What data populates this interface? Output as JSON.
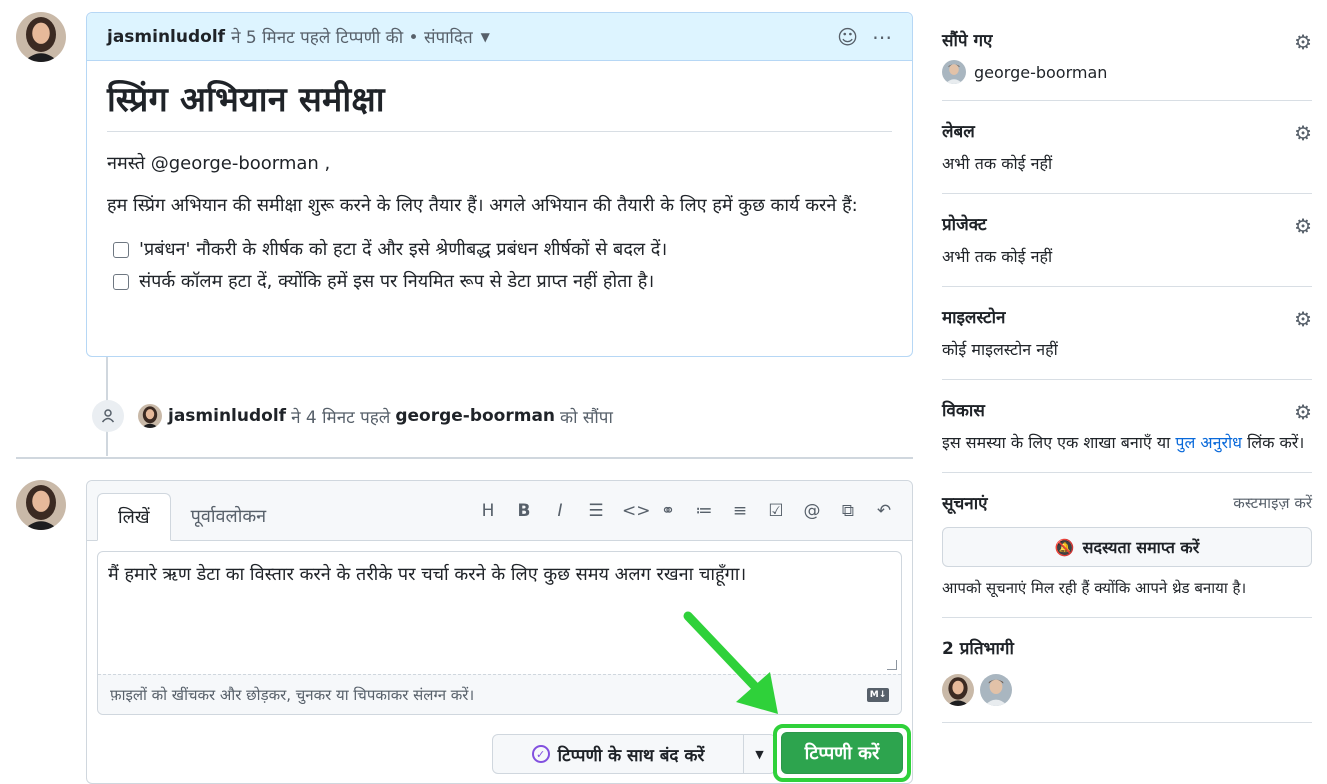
{
  "comment": {
    "author": "jasminludolf",
    "meta": "ने 5 मिनट पहले टिप्पणी की • संपादित",
    "title": "स्प्रिंग अभियान समीक्षा",
    "greeting": "नमस्ते @george-boorman ,",
    "body": "हम स्प्रिंग अभियान की समीक्षा शुरू करने के लिए तैयार हैं। अगले अभियान की तैयारी के लिए हमें कुछ कार्य करने हैं:",
    "tasks": [
      "'प्रबंधन' नौकरी के शीर्षक को हटा दें और इसे श्रेणीबद्ध प्रबंधन शीर्षकों से बदल दें।",
      "संपर्क कॉलम हटा दें, क्योंकि हमें इस पर नियमित रूप से डेटा प्राप्त नहीं होता है।"
    ]
  },
  "event": {
    "actor": "jasminludolf",
    "verb_pre": "ने 4 मिनट पहले",
    "target": "george-boorman",
    "verb_post": "को सौंपा"
  },
  "composer": {
    "tab_write": "लिखें",
    "tab_preview": "पूर्वावलोकन",
    "toolbar": [
      "H",
      "B",
      "I"
    ],
    "text": "मैं हमारे ऋण डेटा का विस्तार करने के तरीके पर चर्चा करने के लिए कुछ समय अलग रखना चाहूँगा।",
    "drop_hint": "फ़ाइलों को खींचकर और छोड़कर, चुनकर या चिपकाकर संलग्न करें।",
    "md_badge": "M↓",
    "close_label": "टिप्पणी के साथ बंद करें",
    "submit_label": "टिप्पणी करें"
  },
  "sidebar": {
    "assignees": {
      "title": "सौंपे गए",
      "user": "george-boorman"
    },
    "labels": {
      "title": "लेबल",
      "value": "अभी तक कोई नहीं"
    },
    "projects": {
      "title": "प्रोजेक्ट",
      "value": "अभी तक कोई नहीं"
    },
    "milestone": {
      "title": "माइलस्टोन",
      "value": "कोई माइलस्टोन नहीं"
    },
    "development": {
      "title": "विकास",
      "text_pre": "इस समस्या के लिए एक शाखा बनाएँ या",
      "link": "पुल अनुरोध",
      "text_post": "लिंक करें।"
    },
    "notifications": {
      "title": "सूचनाएं",
      "customize": "कस्टमाइज़ करें",
      "button": "सदस्यता समाप्त करें",
      "reason": "आपको सूचनाएं मिल रही हैं क्योंकि आपने थ्रेड बनाया है।"
    },
    "participants": {
      "title": "2 प्रतिभागी"
    }
  },
  "colors": {
    "accent_green": "#2da44e",
    "highlight": "#2fd13a",
    "link_blue": "#0969da"
  }
}
